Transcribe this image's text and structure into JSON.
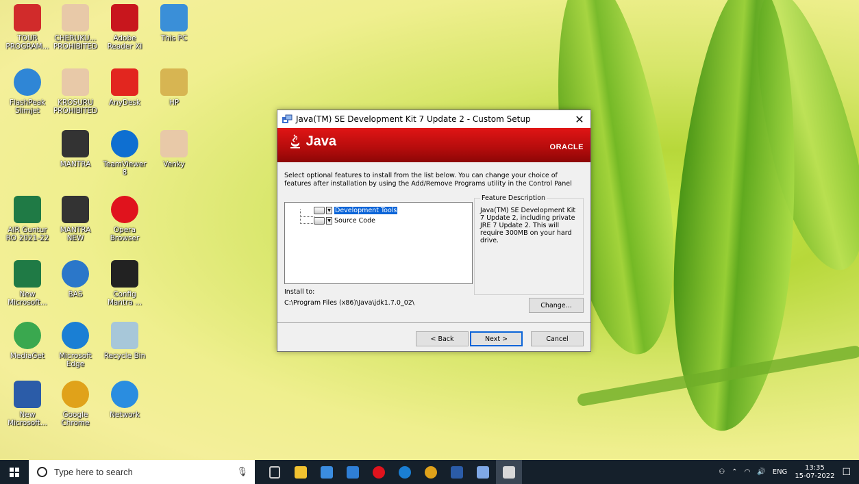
{
  "desktop": {
    "icons": [
      {
        "label": "TOUR\nPROGRAM...",
        "icon": "pdf-icon"
      },
      {
        "label": "CHERUKU...\nPROHIBITED",
        "icon": "pdf-doc-icon"
      },
      {
        "label": "Adobe\nReader XI",
        "icon": "adobe-reader-icon"
      },
      {
        "label": "This PC",
        "icon": "this-pc-icon"
      },
      {
        "label": "FlashPeak\nSlimjet",
        "icon": "slimjet-icon"
      },
      {
        "label": "KROSURU\nPROHIBITED",
        "icon": "pdf-doc-icon"
      },
      {
        "label": "AnyDesk",
        "icon": "anydesk-icon"
      },
      {
        "label": "HP",
        "icon": "user-folder-icon"
      },
      {
        "label": "MANTRA",
        "icon": "mantra-icon"
      },
      {
        "label": "TeamViewer\n8",
        "icon": "teamviewer-icon"
      },
      {
        "label": "Venky",
        "icon": "pdf-doc-icon"
      },
      {
        "label": "AIR Guntur\nRO 2021-22",
        "icon": "excel-icon"
      },
      {
        "label": "MANTRA\nNEW",
        "icon": "mantra-icon"
      },
      {
        "label": "Opera\nBrowser",
        "icon": "opera-icon"
      },
      {
        "label": "New\nMicrosoft...",
        "icon": "excel-icon"
      },
      {
        "label": "BAS",
        "icon": "clock-calendar-icon"
      },
      {
        "label": "Config\nMantra ...",
        "icon": "fingerprint-scanner-icon"
      },
      {
        "label": "MediaGet",
        "icon": "mediaget-icon"
      },
      {
        "label": "Microsoft\nEdge",
        "icon": "edge-icon"
      },
      {
        "label": "Recycle Bin",
        "icon": "recycle-bin-icon"
      },
      {
        "label": "New\nMicrosoft...",
        "icon": "word-icon"
      },
      {
        "label": "Google\nChrome",
        "icon": "chrome-icon"
      },
      {
        "label": "Network",
        "icon": "network-icon"
      }
    ]
  },
  "dialog": {
    "title": "Java(TM) SE Development Kit 7 Update 2 - Custom Setup",
    "close_glyph": "✕",
    "banner_logo": "Java",
    "banner_brand": "ORACLE",
    "instructions": "Select optional features to install from the list below.  You can change your choice of features after installation by using the Add/Remove Programs utility in the Control Panel",
    "features": [
      {
        "label": "Development Tools",
        "selected": true
      },
      {
        "label": "Source Code",
        "selected": false
      }
    ],
    "feature_description_title": "Feature Description",
    "feature_description": "Java(TM) SE Development Kit 7 Update 2, including private JRE 7 Update 2.  This will require 300MB on your hard drive.",
    "install_to_label": "Install to:",
    "install_path": "C:\\Program Files (x86)\\Java\\jdk1.7.0_02\\",
    "change_button": "Change...",
    "back_button": "< Back",
    "next_button": "Next >",
    "cancel_button": "Cancel"
  },
  "taskbar": {
    "search_placeholder": "Type here to search",
    "pinned": [
      "task-view-icon",
      "file-explorer-icon",
      "store-icon",
      "mail-icon",
      "opera-icon",
      "edge-icon",
      "chrome-icon",
      "word-icon",
      "installer-icon",
      "java-setup-icon"
    ],
    "tray": {
      "language": "ENG",
      "time": "13:35",
      "date": "15-07-2022"
    }
  }
}
